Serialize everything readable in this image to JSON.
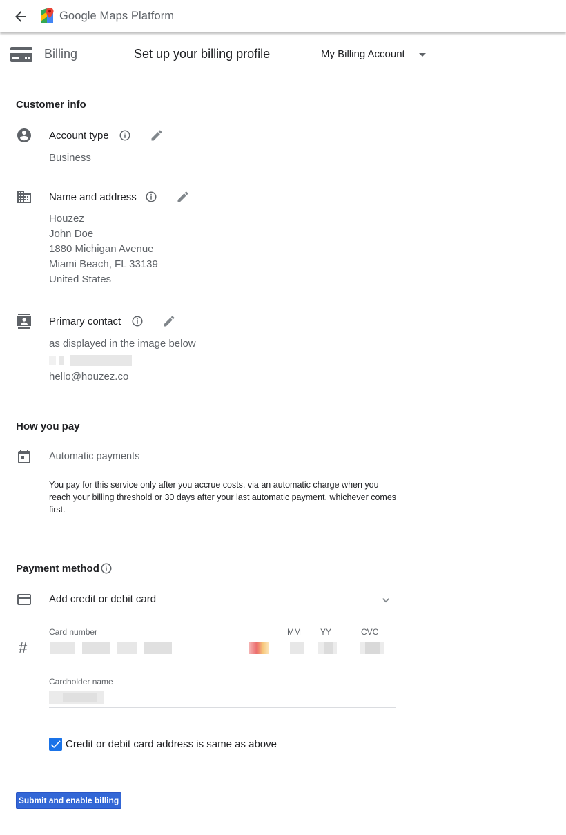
{
  "header": {
    "brand": "Google Maps Platform"
  },
  "subheader": {
    "section_label": "Billing",
    "title": "Set up your billing profile",
    "account": "My Billing Account"
  },
  "customer_info": {
    "heading": "Customer info",
    "account_type": {
      "label": "Account type",
      "value": "Business"
    },
    "name_address": {
      "label": "Name and address",
      "lines": [
        "Houzez",
        "John Doe",
        "1880 Michigan Avenue",
        "Miami Beach, FL 33139",
        "United States"
      ]
    },
    "primary_contact": {
      "label": "Primary contact",
      "name": "as displayed in the image below",
      "email": "hello@houzez.co"
    }
  },
  "how_you_pay": {
    "heading": "How you pay",
    "method": "Automatic payments",
    "description": "You pay for this service only after you accrue costs, via an automatic charge when you reach your billing threshold or 30 days after your last automatic payment, whichever comes first."
  },
  "payment_method": {
    "heading": "Payment method",
    "selector": "Add credit or debit card",
    "hash_symbol": "#",
    "card_number_label": "Card number",
    "mm_label": "MM",
    "yy_label": "YY",
    "cvc_label": "CVC",
    "cardholder_label": "Cardholder name",
    "same_address_label": "Credit or debit card address is same as above"
  },
  "submit_label": "Submit and enable billing",
  "colors": {
    "accent": "#1a73e8",
    "button": "#3367d6",
    "muted_text": "#5f6368",
    "divider": "#dadce0"
  }
}
